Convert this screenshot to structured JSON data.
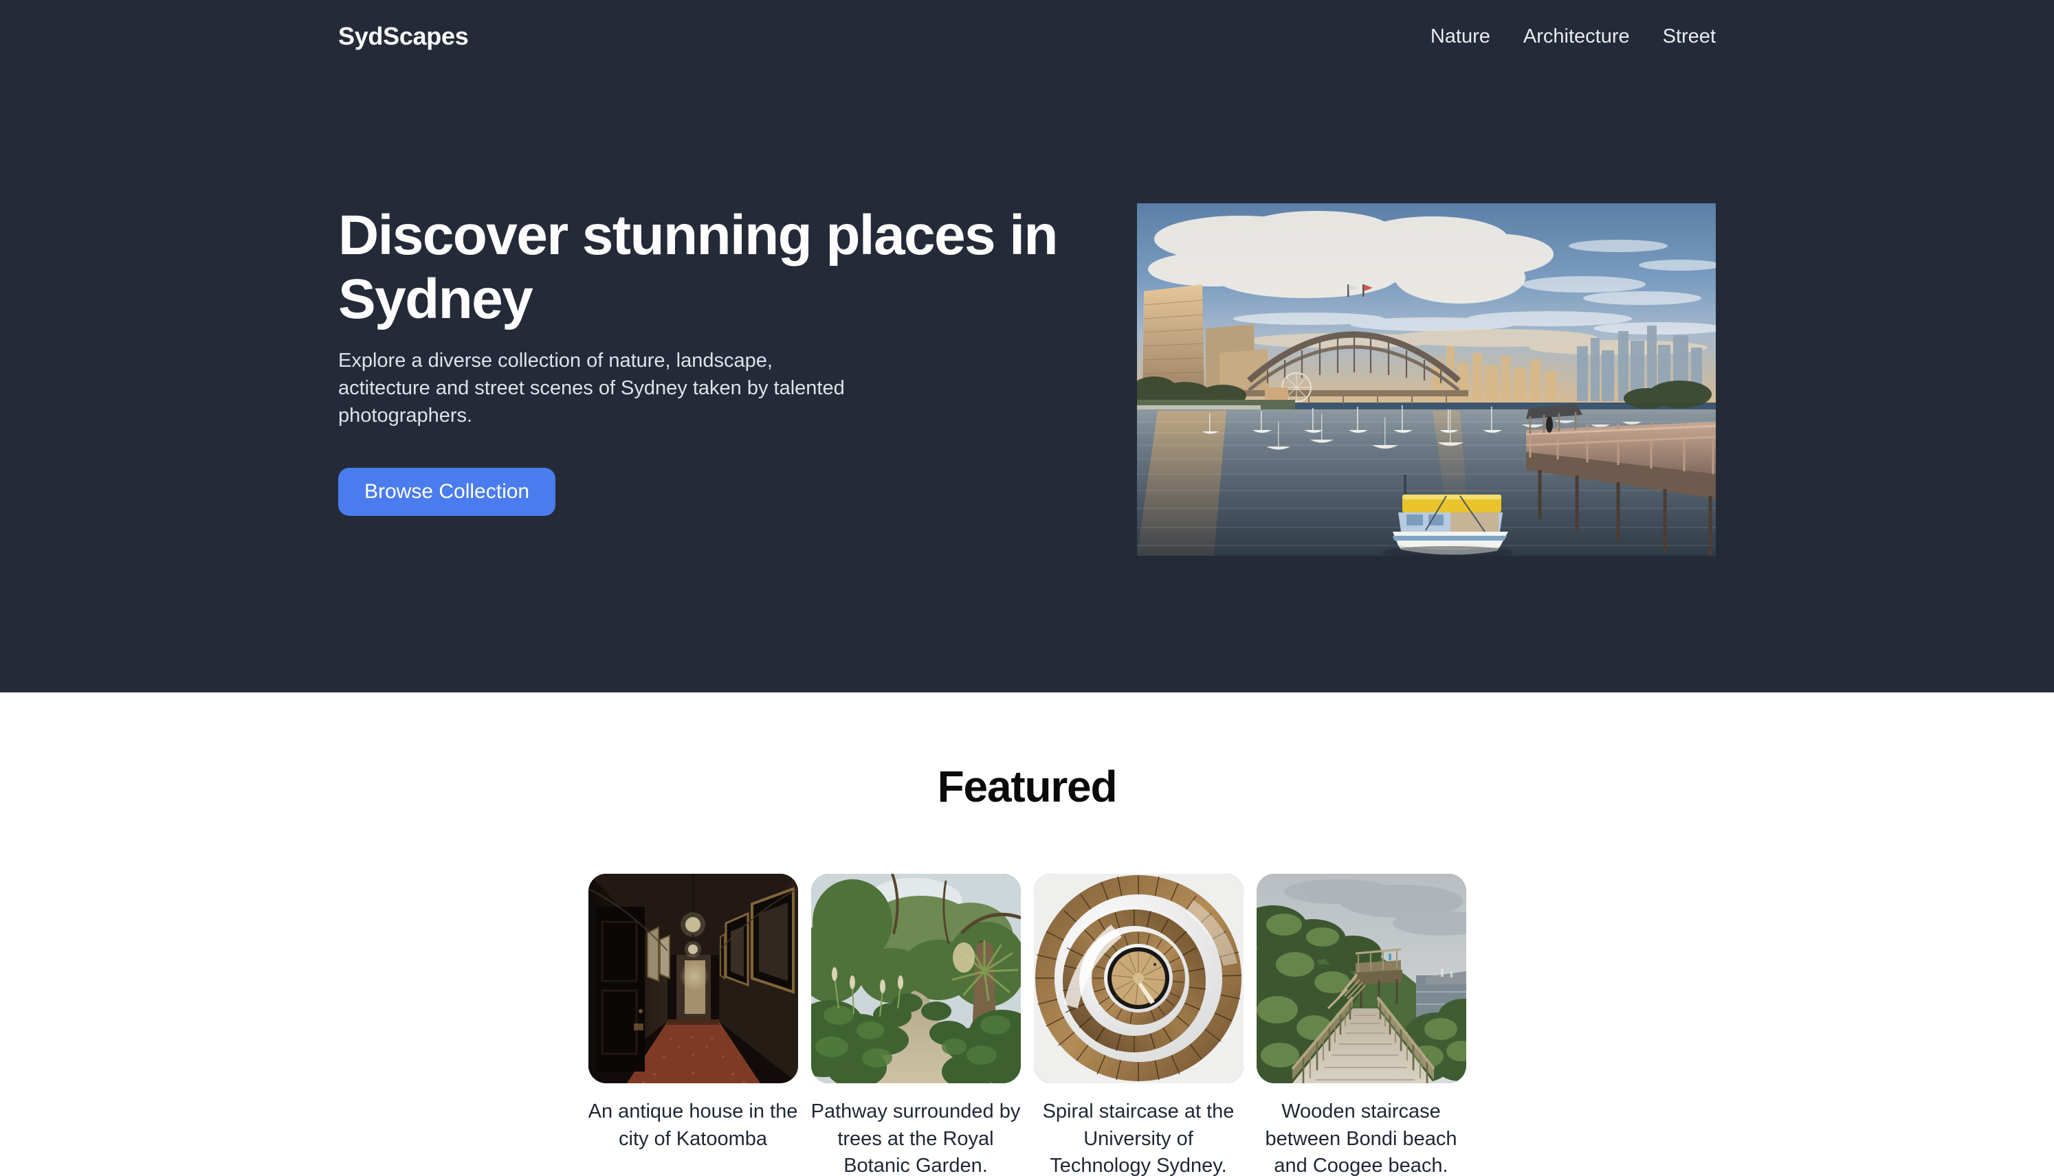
{
  "theme": {
    "dark_bg": "#242a37",
    "light_bg": "#ffffff",
    "accent": "#4a7cee",
    "heading_light": "#fdfdfd",
    "heading_dark": "#0a0a0a",
    "body_text_light": "#dfe2e8",
    "caption_text": "#1f2735"
  },
  "header": {
    "brand": "SydScapes",
    "nav": [
      {
        "label": "Nature"
      },
      {
        "label": "Architecture"
      },
      {
        "label": "Street"
      }
    ]
  },
  "hero": {
    "title": "Discover stunning places in Sydney",
    "subtitle": "Explore a diverse collection of nature, landscape, actitecture and street scenes of Sydney taken by talented photographers.",
    "cta_label": "Browse Collection",
    "image_alt": "Sydney Harbour Bridge at sunset seen across Lavender Bay with moored sailboats and a timber pier"
  },
  "featured": {
    "heading": "Featured",
    "cards": [
      {
        "caption": "An antique house in the city of Katoomba",
        "image_alt": "Dim hotel hallway with red patterned carpet, framed pictures and pendant lamps"
      },
      {
        "caption": "Pathway surrounded by trees at the Royal Botanic Garden.",
        "image_alt": "Gravel pathway winding through dense green garden foliage and tall trees"
      },
      {
        "caption": "Spiral staircase at the University of Technology Sydney.",
        "image_alt": "Spiral staircase seen from above with white balustrades and bronze treads"
      },
      {
        "caption": "Wooden staircase between Bondi beach and Coogee beach.",
        "image_alt": "Timber boardwalk and stairs along a green coastal headland under an overcast sky"
      }
    ]
  }
}
